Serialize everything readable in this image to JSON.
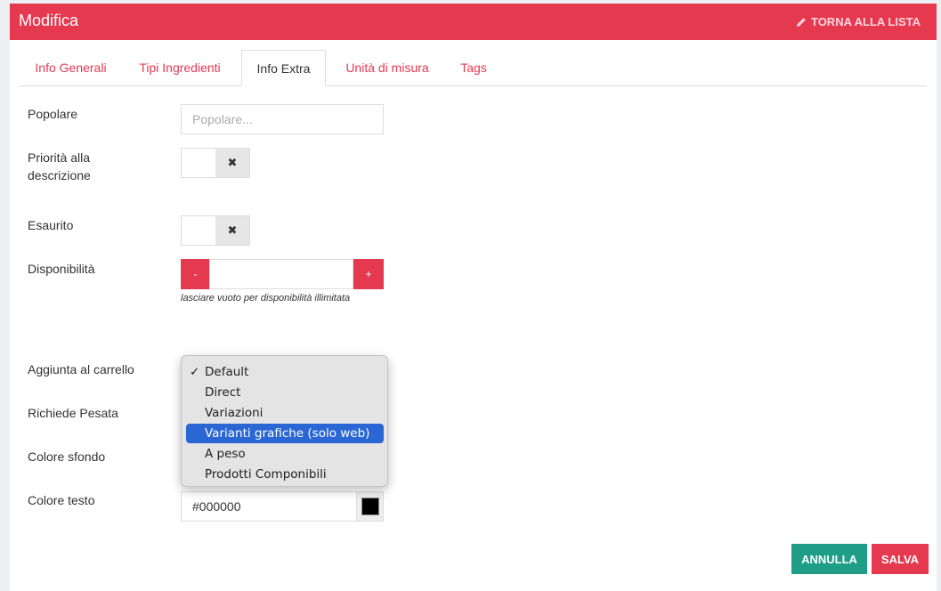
{
  "header": {
    "title": "Modifica",
    "back_label": "TORNA ALLA LISTA"
  },
  "tabs": [
    {
      "label": "Info Generali",
      "active": false
    },
    {
      "label": "Tipi Ingredienti",
      "active": false
    },
    {
      "label": "Info Extra",
      "active": true
    },
    {
      "label": "Unità di misura",
      "active": false
    },
    {
      "label": "Tags",
      "active": false
    }
  ],
  "form": {
    "popolare": {
      "label": "Popolare",
      "placeholder": "Popolare..."
    },
    "priorita": {
      "label_line1": "Priorità alla",
      "label_line2": "descrizione",
      "toggle_glyph": "✖"
    },
    "esaurito": {
      "label": "Esaurito",
      "toggle_glyph": "✖"
    },
    "disponibilita": {
      "label": "Disponibilità",
      "minus": "-",
      "plus": "+",
      "value": "",
      "help": "lasciare vuoto per disponibilità illimitata"
    },
    "aggiunta": {
      "label": "Aggiunta al carrello",
      "options": [
        "Default",
        "Direct",
        "Variazioni",
        "Varianti grafiche (solo web)",
        "A peso",
        "Prodotti Componibili"
      ],
      "checked": "Default",
      "highlighted": "Varianti grafiche (solo web)"
    },
    "pesata": {
      "label": "Richiede Pesata"
    },
    "colore_sfondo": {
      "label": "Colore sfondo"
    },
    "colore_testo": {
      "label": "Colore testo",
      "value": "#000000",
      "swatch_color": "#000000"
    }
  },
  "actions": {
    "cancel_label": "ANNULLA",
    "save_label": "SALVA"
  },
  "colors": {
    "accent": "#e53950",
    "cancel": "#1f9e87",
    "selection": "#2a67d5"
  }
}
